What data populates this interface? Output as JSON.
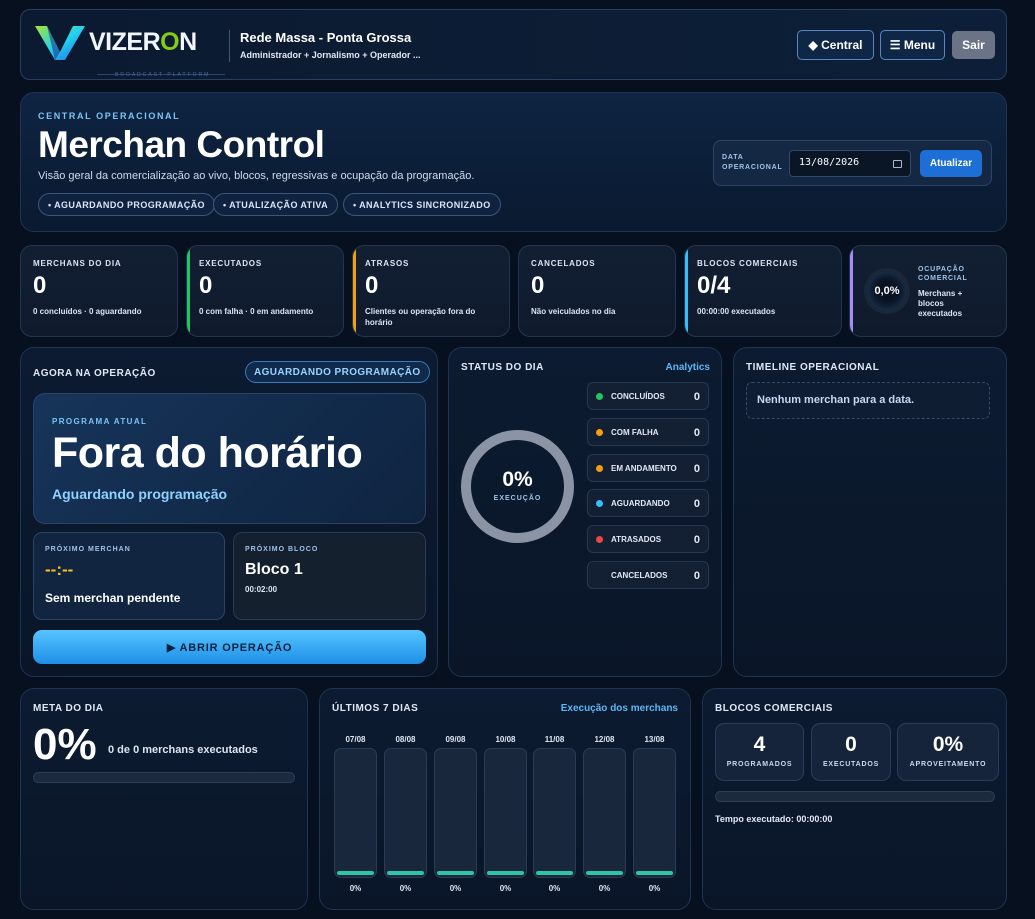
{
  "header": {
    "logo_text": "VIZER",
    "logo_subtitle": "BROADCAST PLATFORM",
    "station": "Rede Massa - Ponta Grossa",
    "roles": "Administrador + Jornalismo + Operador ...",
    "central_label": "◆ Central",
    "menu_label": "☰ Menu",
    "logout_label": "Sair"
  },
  "hero": {
    "eyebrow": "CENTRAL OPERACIONAL",
    "title": "Merchan Control",
    "subtitle": "Visão geral da comercialização ao vivo, blocos, regressivas e ocupação da programação.",
    "pills": [
      "• AGUARDANDO PROGRAMAÇÃO",
      "• ATUALIZAÇÃO ATIVA",
      "• ANALYTICS SINCRONIZADO"
    ],
    "date_label_1": "DATA",
    "date_label_2": "OPERACIONAL",
    "date_value": "13/08/2026",
    "refresh_label": "Atualizar"
  },
  "kpis": [
    {
      "title": "MERCHANS DO DIA",
      "value": "0",
      "sub": "0 concluídos · 0 aguardando",
      "accent": ""
    },
    {
      "title": "EXECUTADOS",
      "value": "0",
      "sub": "0 com falha · 0 em andamento",
      "accent": "#22c55e"
    },
    {
      "title": "ATRASOS",
      "value": "0",
      "sub": "Clientes ou operação fora do horário",
      "accent": "#f59e0b"
    },
    {
      "title": "CANCELADOS",
      "value": "0",
      "sub": "Não veiculados no dia",
      "accent": ""
    },
    {
      "title": "BLOCOS COMERCIAIS",
      "value": "0/4",
      "sub": "00:00:00 executados",
      "accent": "#38bdf8"
    }
  ],
  "occupancy": {
    "title_1": "OCUPAÇÃO",
    "title_2": "COMERCIAL",
    "value": "0,0%",
    "sub": "Merchans + blocos executados",
    "accent": "#a78bfa"
  },
  "now": {
    "title": "AGORA NA OPERAÇÃO",
    "status": "AGUARDANDO PROGRAMAÇÃO",
    "program_label": "PROGRAMA ATUAL",
    "program_name": "Fora do horário",
    "program_status": "Aguardando programação",
    "next_merchan_label": "PRÓXIMO MERCHAN",
    "next_merchan_time": "--:--",
    "next_merchan_text": "Sem merchan pendente",
    "next_block_label": "PRÓXIMO BLOCO",
    "next_block_name": "Bloco 1",
    "next_block_time": "00:02:00",
    "open_label": "▶ ABRIR OPERAÇÃO"
  },
  "status_day": {
    "title": "STATUS DO DIA",
    "link": "Analytics",
    "gauge_value": "0%",
    "gauge_label": "EXECUÇÃO",
    "rows": [
      {
        "label": "CONCLUÍDOS",
        "value": "0",
        "color": "#22c55e"
      },
      {
        "label": "COM FALHA",
        "value": "0",
        "color": "#f59e0b"
      },
      {
        "label": "EM ANDAMENTO",
        "value": "0",
        "color": "#f59e0b"
      },
      {
        "label": "AGUARDANDO",
        "value": "0",
        "color": "#38bdf8"
      },
      {
        "label": "ATRASADOS",
        "value": "0",
        "color": "#ef4444"
      },
      {
        "label": "CANCELADOS",
        "value": "0",
        "color": ""
      }
    ]
  },
  "timeline": {
    "title": "TIMELINE OPERACIONAL",
    "empty": "Nenhum merchan para a data."
  },
  "goal": {
    "title": "META DO DIA",
    "value": "0%",
    "text": "0 de 0 merchans executados"
  },
  "last7": {
    "title": "ÚLTIMOS 7 DIAS",
    "link": "Execução dos merchans",
    "days": [
      {
        "label": "07/08",
        "value": "0%"
      },
      {
        "label": "08/08",
        "value": "0%"
      },
      {
        "label": "09/08",
        "value": "0%"
      },
      {
        "label": "10/08",
        "value": "0%"
      },
      {
        "label": "11/08",
        "value": "0%"
      },
      {
        "label": "12/08",
        "value": "0%"
      },
      {
        "label": "13/08",
        "value": "0%"
      }
    ]
  },
  "blocks": {
    "title": "BLOCOS COMERCIAIS",
    "programmed_value": "4",
    "programmed_label": "PROGRAMADOS",
    "executed_value": "0",
    "executed_label": "EXECUTADOS",
    "use_value": "0%",
    "use_label": "APROVEITAMENTO",
    "time_text": "Tempo executado: 00:00:00"
  }
}
